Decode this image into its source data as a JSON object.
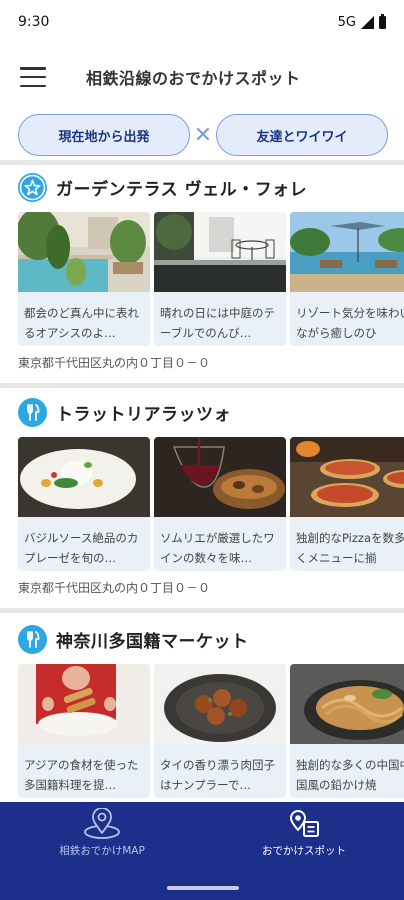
{
  "status": {
    "time": "9:30",
    "network": "5G"
  },
  "app_bar": {
    "title": "相鉄沿線のおでかけスポット",
    "menu_icon": "hamburger-menu-icon"
  },
  "filters": {
    "chip1": "現在地から出発",
    "separator": "✕",
    "chip2": "友達とワイワイ"
  },
  "colors": {
    "accent": "#2fa6e4",
    "nav_bg": "#1c2f8b",
    "chip_bg": "#e4ecfb",
    "chip_border": "#7d9bdc",
    "card_bg": "#eaf0f8"
  },
  "sections": [
    {
      "icon": "star-icon",
      "title": "ガーデンテラス ヴェル・フォレ",
      "address": "東京都千代田区丸の内０丁目０－０",
      "cards": [
        {
          "image": "pool-garden-photo",
          "text": "都会のど真ん中に表れるオアシスのよ…"
        },
        {
          "image": "terrace-table-photo",
          "text": "晴れの日には中庭のテーブルでのんび…"
        },
        {
          "image": "resort-lounge-photo",
          "text": "リゾート気分を味わいながら癒しのひ"
        }
      ]
    },
    {
      "icon": "fork-knife-icon",
      "title": "トラットリアラッツォ",
      "address": "東京都千代田区丸の内０丁目０－０",
      "cards": [
        {
          "image": "caprese-dish-photo",
          "text": "バジルソース絶品のカプレーゼを旬の…"
        },
        {
          "image": "wine-pour-photo",
          "text": "ソムリエが厳選したワインの数々を味…"
        },
        {
          "image": "pizza-photo",
          "text": "独創的なPizzaを数多くメニューに揃"
        }
      ]
    },
    {
      "icon": "fork-knife-icon",
      "title": "神奈川多国籍マーケット",
      "cards": [
        {
          "image": "spring-roll-photo",
          "text": "アジアの食材を使った多国籍料理を提…"
        },
        {
          "image": "meatball-photo",
          "text": "タイの香り漂う肉団子はナンプラーで…"
        },
        {
          "image": "noodle-photo",
          "text": "独創的な多くの中国中国風の鉛かけ焼"
        }
      ]
    }
  ],
  "bottom_nav": [
    {
      "icon": "map-pin-icon",
      "label": "相鉄おでかけMAP",
      "active": false
    },
    {
      "icon": "spot-list-icon",
      "label": "おでかけスポット",
      "active": true
    }
  ]
}
